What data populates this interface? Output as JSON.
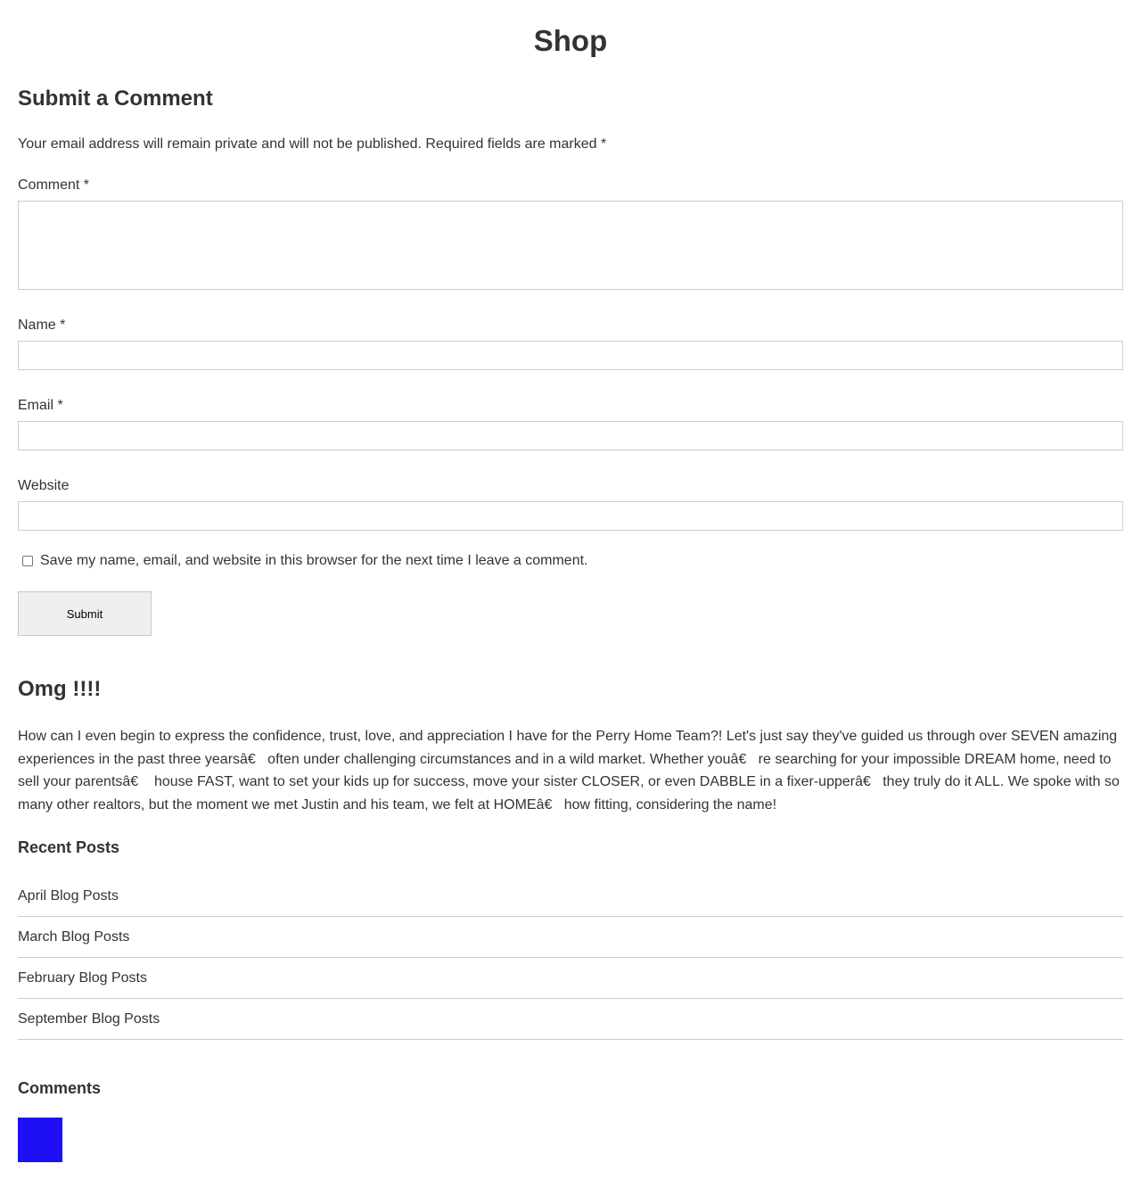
{
  "page": {
    "title": "Shop"
  },
  "respond": {
    "title": "Submit a Comment",
    "note": "Your email address will remain private and will not be published. Required fields are marked *",
    "comment_label": "Comment *",
    "comment_value": "",
    "name_label": "Name *",
    "name_value": "",
    "email_label": "Email *",
    "email_value": "",
    "website_label": "Website",
    "website_value": "",
    "cookies_label": "Save my name, email, and website in this browser for the next time I leave a comment.",
    "cookies_checked": false,
    "submit_label": "Submit"
  },
  "post": {
    "title": "Omg !!!!",
    "body": "How can I even begin to express the confidence, trust, love, and appreciation I have for the Perry Home Team?! Let's just say they've guided us through over SEVEN amazing experiences in the past three yearsâ€   often under challenging circumstances and in a wild market. Whether youâ€   re searching for your impossible DREAM home, need to sell your parentsâ€    house FAST, want to set your kids up for success, move your sister CLOSER, or even DABBLE in a fixer-upperâ€   they truly do it ALL. We spoke with so many other realtors, but the moment we met Justin and his team, we felt at HOMEâ€   how fitting, considering the name!"
  },
  "recent_posts": {
    "title": "Recent Posts",
    "items": [
      {
        "label": "April Blog Posts"
      },
      {
        "label": "March Blog Posts"
      },
      {
        "label": "February Blog Posts"
      },
      {
        "label": "September Blog Posts"
      }
    ]
  },
  "comments": {
    "title": "Comments",
    "avatar_color": "#1e0ff5"
  }
}
